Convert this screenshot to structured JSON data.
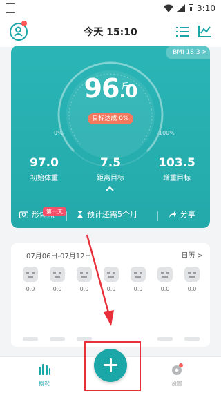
{
  "status_bar": {
    "time": "3:10"
  },
  "header": {
    "title": "今天 15:10",
    "accent_color": "#1ba7a8"
  },
  "summary": {
    "bmi": "BMI 18.3 >",
    "weight": "96",
    "weight_decimal": ".0",
    "unit": "斤",
    "goal_status": "目标达成 0%",
    "gauge_start": "0%",
    "gauge_end": "100%",
    "stats": [
      {
        "value": "97.0",
        "label": "初始体重"
      },
      {
        "value": "7.5",
        "label": "距离目标"
      },
      {
        "value": "103.5",
        "label": "增重目标"
      }
    ],
    "body_photo_label": "形体照",
    "first_day_badge": "第一天",
    "estimate_label": "预计还需5个月",
    "share_label": "分享"
  },
  "calendar": {
    "range": "07月06日-07月12日",
    "link": "日历 >",
    "values": [
      "0.0",
      "0.0",
      "0.0",
      "0.0",
      "0.0",
      "0.0",
      "0.0"
    ]
  },
  "tabbar": {
    "overview": "概况",
    "settings": "设置"
  },
  "colors": {
    "card": "#23a9aa",
    "goal_pill": "#f4785d",
    "badge": "#f4506a",
    "annotation": "#e8303a"
  }
}
